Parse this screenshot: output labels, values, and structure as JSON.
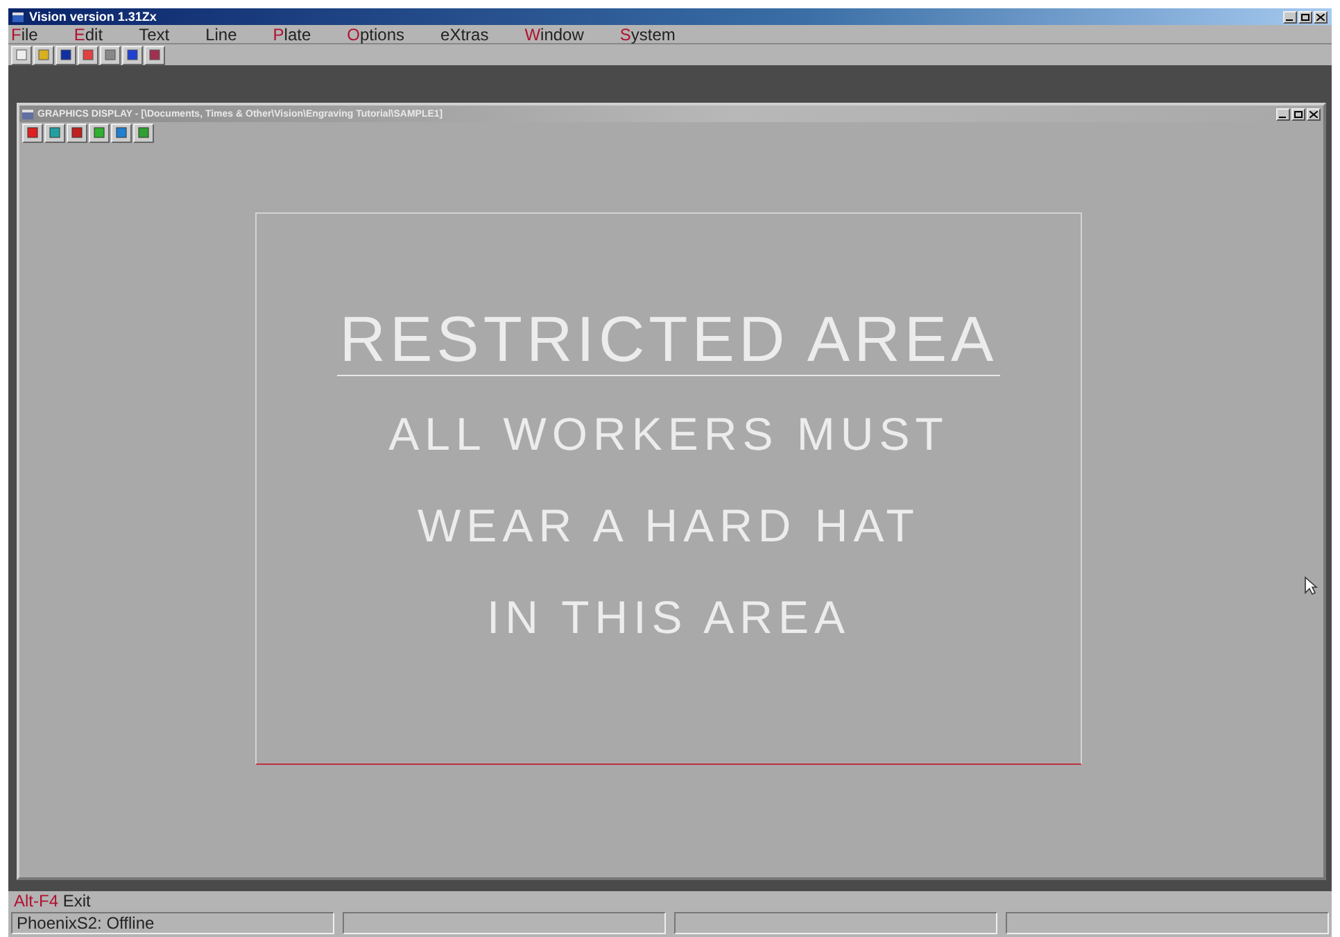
{
  "window": {
    "title": "Vision version 1.31Zx"
  },
  "menu": [
    {
      "label": "File",
      "accent": true
    },
    {
      "label": "Edit",
      "accent": true
    },
    {
      "label": "Text",
      "accent": false
    },
    {
      "label": "Line",
      "accent": false
    },
    {
      "label": "Plate",
      "accent": true
    },
    {
      "label": "Options",
      "accent": true
    },
    {
      "label": "eXtras",
      "accent": false
    },
    {
      "label": "Window",
      "accent": true
    },
    {
      "label": "System",
      "accent": true
    }
  ],
  "graphics_window": {
    "title": "GRAPHICS DISPLAY - [\\Documents, Times & Other\\Vision\\Engraving Tutorial\\SAMPLE1]",
    "sign": {
      "heading": "RESTRICTED AREA",
      "lines": [
        "ALL WORKERS MUST",
        "WEAR A HARD HAT",
        "IN THIS AREA"
      ]
    }
  },
  "hint": {
    "key": "Alt-F4",
    "action": "Exit"
  },
  "status_bar": [
    "PhoenixS2: Offline"
  ]
}
